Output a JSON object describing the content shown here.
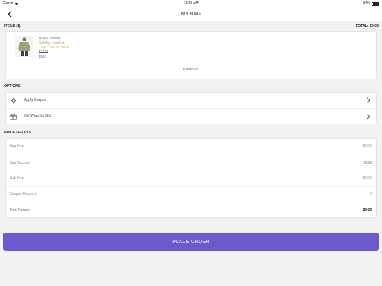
{
  "status_bar": {
    "carrier": "Carrier",
    "time": "11:53 AM",
    "battery": "84%"
  },
  "header": {
    "title": "MY BAG"
  },
  "items_section": {
    "label": "ITEMS (1)",
    "total_label": "TOTAL: $0.00"
  },
  "item": {
    "name": "Acqua Limone",
    "seller": "Sold by: Funfash",
    "stock": "Only 1 unit in Stock",
    "mrp": "$1234",
    "price": "$899",
    "remove_label": "REMOVE"
  },
  "options_section": {
    "label": "OPTIONS",
    "items": [
      {
        "label": "Apply Coupon",
        "icon": "gear-icon"
      },
      {
        "label": "Gift Wrap for $25",
        "icon": "gift-box-icon"
      }
    ]
  },
  "price_section": {
    "label": "PRICE DETAILS",
    "rows": [
      {
        "label": "Bag Total",
        "value": "$0.00"
      },
      {
        "label": "Bag Discount",
        "value": "-$335"
      },
      {
        "label": "Sub Total",
        "value": "$0.00"
      },
      {
        "label": "Coupon Discount",
        "value": "0"
      },
      {
        "label": "Total Payable",
        "value": "$0.00"
      }
    ]
  },
  "footer": {
    "place_order_label": "PLACE ORDER"
  },
  "colors": {
    "accent": "#6a5acd",
    "stock_warning": "#e8c13a"
  }
}
